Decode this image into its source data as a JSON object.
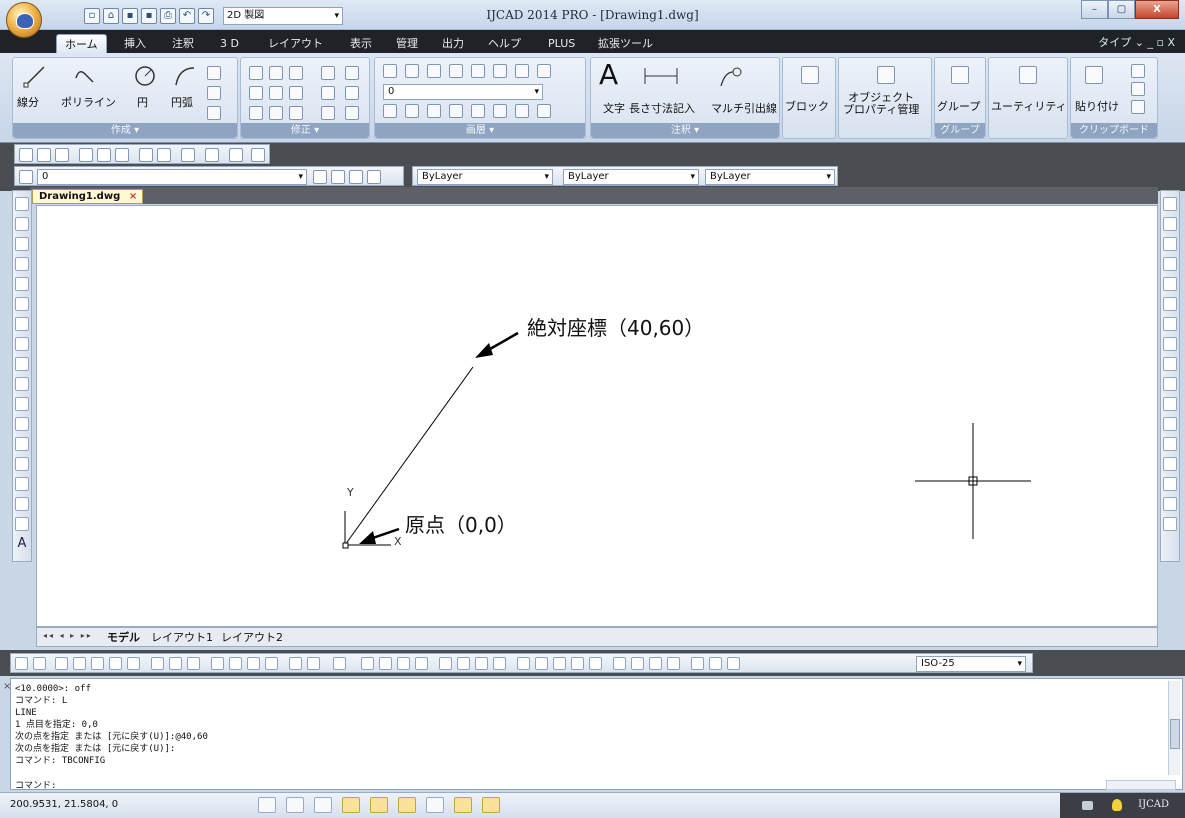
{
  "window": {
    "title": "IJCAD 2014 PRO - [Drawing1.dwg]",
    "workspace": "2D 製図",
    "controls": {
      "minimize": "–",
      "maximize": "▢",
      "close": "X"
    }
  },
  "ribbon_tabs": [
    "ホーム",
    "挿入",
    "注釈",
    "3 D",
    "レイアウト",
    "表示",
    "管理",
    "出力",
    "ヘルプ",
    "PLUS",
    "拡張ツール"
  ],
  "ribbon_tab_active": "ホーム",
  "type_menu": "タイプ ⌄ _ ▫ X",
  "ribbon": {
    "draw": {
      "title": "作成 ▾",
      "buttons": [
        "線分",
        "ポリライン",
        "円",
        "円弧"
      ]
    },
    "modify": {
      "title": "修正 ▾"
    },
    "layer": {
      "title": "画層 ▾",
      "current": "0"
    },
    "annotation": {
      "title": "注釈 ▾",
      "buttons": [
        "文字",
        "長さ寸法記入",
        "マルチ引出線"
      ]
    },
    "block": {
      "label": "ブロック"
    },
    "properties": {
      "label": "オブジェクト\nプロパティ管理"
    },
    "group": {
      "label": "グループ",
      "title": "グループ"
    },
    "utility": {
      "label": "ユーティリティ"
    },
    "clipboard": {
      "label": "貼り付け",
      "title": "クリップボード"
    }
  },
  "props_toolbar": {
    "layer": "0",
    "color": "ByLayer",
    "linetype": "ByLayer",
    "lineweight": "ByLayer"
  },
  "document_tab": {
    "name": "Drawing1.dwg",
    "close": "×"
  },
  "drawing": {
    "annotation_point": "絶対座標（40,60）",
    "annotation_origin": "原点（0,0）",
    "ucs_x": "X",
    "ucs_y": "Y"
  },
  "layout_tabs": {
    "nav": "◂◂ ◂ ▸ ▸▸",
    "items": [
      "モデル",
      "レイアウト1",
      "レイアウト2"
    ],
    "active": "モデル"
  },
  "snap_toolbar": {
    "dimstyle": "ISO-25"
  },
  "command": {
    "lines": [
      "<10.0000>: off",
      "コマンド: L",
      "LINE",
      "1 点目を指定: 0,0",
      "次の点を指定 または [元に戻す(U)]:@40,60",
      "次の点を指定 または [元に戻す(U)]:",
      "コマンド: TBCONFIG"
    ],
    "prompt": "コマンド:"
  },
  "status": {
    "coords": "200.9531, 21.5804, 0",
    "app": "IJCAD"
  }
}
